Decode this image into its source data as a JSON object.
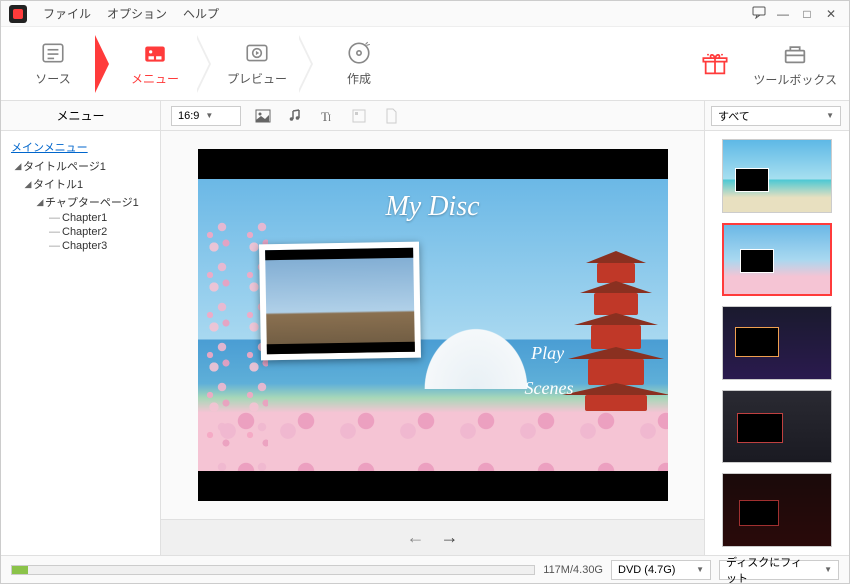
{
  "menubar": {
    "file": "ファイル",
    "option": "オプション",
    "help": "ヘルプ"
  },
  "toolbar": {
    "source": "ソース",
    "menu": "メニュー",
    "preview": "プレビュー",
    "create": "作成",
    "toolbox": "ツールボックス"
  },
  "secbar": {
    "left_label": "メニュー",
    "aspect": "16:9",
    "filter": "すべて"
  },
  "tree": {
    "main_menu": "メインメニュー",
    "title_page": "タイトルページ1",
    "title": "タイトル1",
    "chapter_page": "チャプターページ1",
    "chapters": [
      "Chapter1",
      "Chapter2",
      "Chapter3"
    ]
  },
  "disc_preview": {
    "title": "My Disc",
    "play": "Play",
    "scenes": "Scenes"
  },
  "status": {
    "size": "117M/4.30G",
    "disc_type": "DVD (4.7G)",
    "fit": "ディスクにフィット"
  },
  "colors": {
    "accent": "#ff3b3b"
  }
}
